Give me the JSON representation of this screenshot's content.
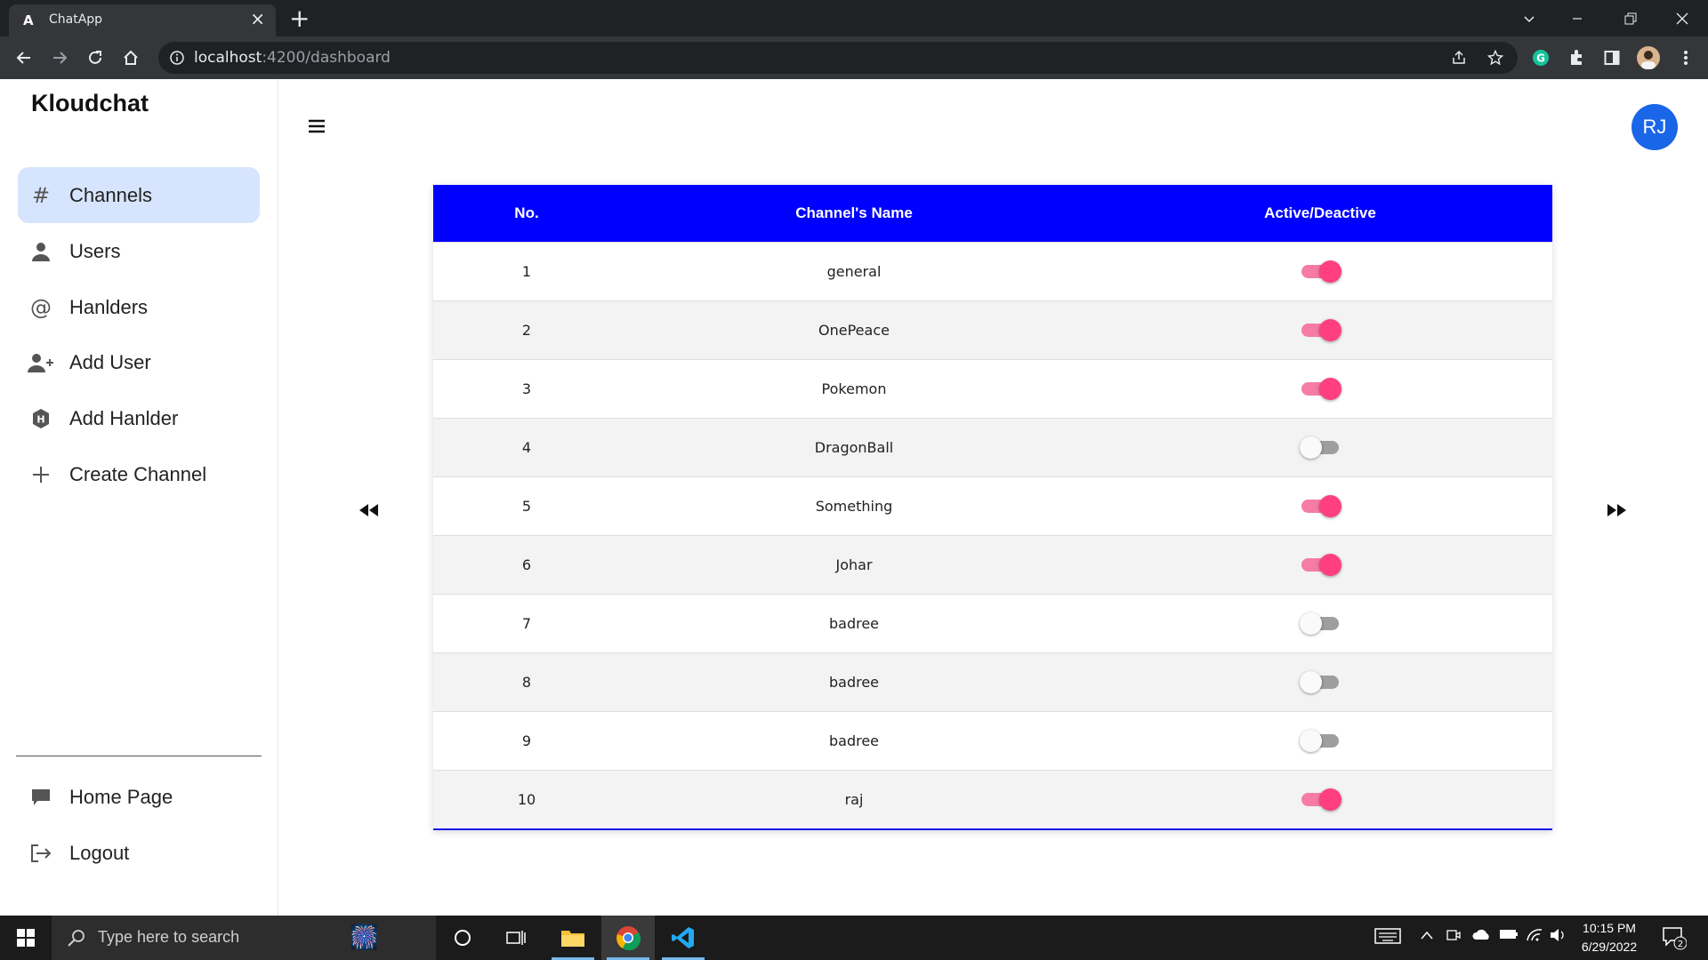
{
  "browser": {
    "tab_title": "ChatApp",
    "tab_favicon": "A",
    "url_host": "localhost",
    "url_path": ":4200/dashboard"
  },
  "sidebar": {
    "brand": "Kloudchat",
    "items": [
      {
        "label": "Channels",
        "icon": "hash-icon",
        "active": true
      },
      {
        "label": "Users",
        "icon": "user-icon",
        "active": false
      },
      {
        "label": "Hanlders",
        "icon": "at-sign-icon",
        "active": false
      },
      {
        "label": "Add User",
        "icon": "add-user-icon",
        "active": false
      },
      {
        "label": "Add Hanlder",
        "icon": "hexagon-h-icon",
        "active": false
      },
      {
        "label": "Create Channel",
        "icon": "plus-icon",
        "active": false
      }
    ],
    "bottom_items": [
      {
        "label": "Home Page",
        "icon": "chat-bubble-icon"
      },
      {
        "label": "Logout",
        "icon": "logout-icon"
      }
    ]
  },
  "header": {
    "avatar_initials": "RJ",
    "avatar_color": "#1a66e8"
  },
  "table": {
    "columns": [
      "No.",
      "Channel's Name",
      "Active/Deactive"
    ],
    "header_color": "#0000ff",
    "rows": [
      {
        "no": "1",
        "name": "general",
        "active": true
      },
      {
        "no": "2",
        "name": "OnePeace",
        "active": true
      },
      {
        "no": "3",
        "name": "Pokemon",
        "active": true
      },
      {
        "no": "4",
        "name": "DragonBall",
        "active": false
      },
      {
        "no": "5",
        "name": "Something",
        "active": true
      },
      {
        "no": "6",
        "name": "Johar",
        "active": true
      },
      {
        "no": "7",
        "name": "badree",
        "active": false
      },
      {
        "no": "8",
        "name": "badree",
        "active": false
      },
      {
        "no": "9",
        "name": "badree",
        "active": false
      },
      {
        "no": "10",
        "name": "raj",
        "active": true
      }
    ]
  },
  "taskbar": {
    "search_placeholder": "Type here to search",
    "time": "10:15 PM",
    "date": "6/29/2022",
    "notifications": "2"
  }
}
